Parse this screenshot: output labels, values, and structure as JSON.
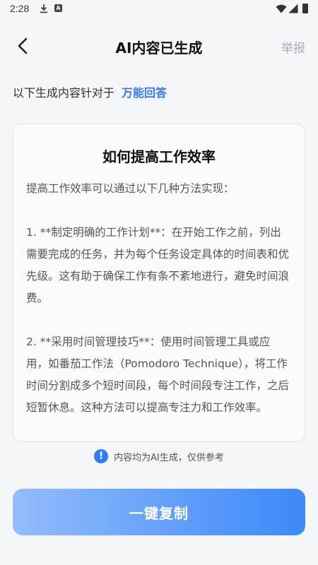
{
  "status_bar": {
    "time": "2:28",
    "a_badge": "A"
  },
  "header": {
    "title": "AI内容已生成",
    "report_label": "举报"
  },
  "target": {
    "prefix": "以下生成内容针对于",
    "name": "万能回答"
  },
  "content": {
    "title": "如何提高工作效率",
    "intro": "提高工作效率可以通过以下几种方法实现：",
    "item1": "1. **制定明确的工作计划**：在开始工作之前，列出需要完成的任务，并为每个任务设定具体的时间表和优先级。这有助于确保工作有条不紊地进行，避免时间浪费。",
    "item2": "2. **采用时间管理技巧**：使用时间管理工具或应用，如番茄工作法（Pomodoro Technique），将工作时间分割成多个短时间段，每个时间段专注工作，之后短暂休息。这种方法可以提高专注力和工作效率。"
  },
  "disclaimer": {
    "icon_char": "!",
    "text": "内容均为AI生成，仅供参考"
  },
  "actions": {
    "copy_label": "一键复制"
  },
  "colors": {
    "accent": "#2f7cf6",
    "muted": "#a8acb3",
    "background": "#f4f6fa"
  },
  "icons": {
    "back": "chevron-left-icon",
    "info": "info-icon",
    "download": "download-icon",
    "wifi": "wifi-icon",
    "signal": "signal-icon",
    "battery": "battery-icon"
  }
}
